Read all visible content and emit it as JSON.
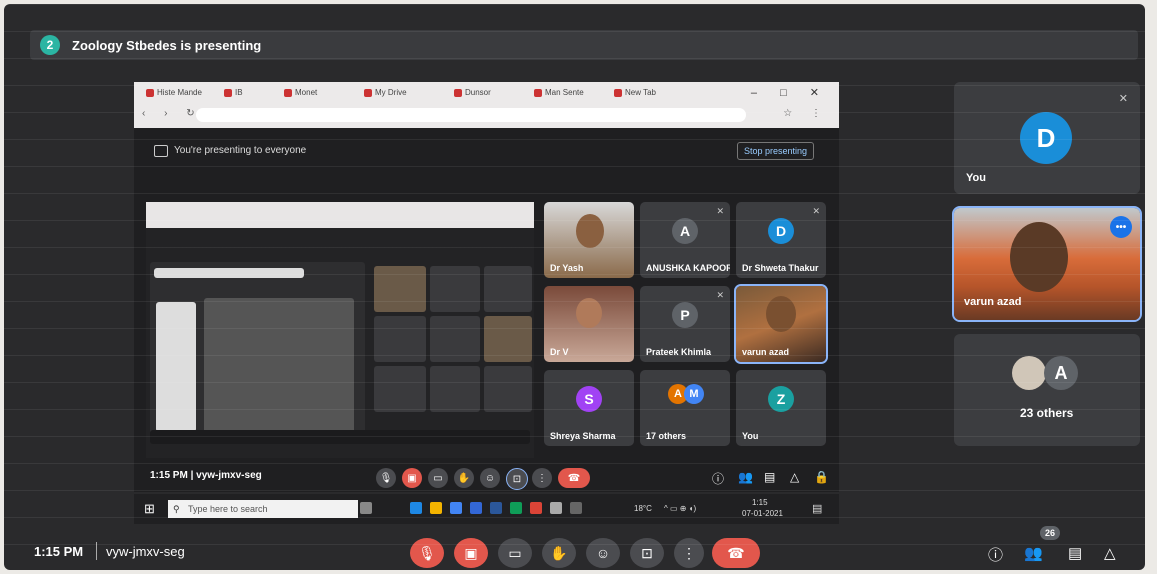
{
  "presentation": {
    "badge": "2",
    "text": "Zoology Stbedes is presenting"
  },
  "shared_screen": {
    "window_controls": "– □ ✕",
    "tabs": [
      "Histe Mande",
      "IB",
      "Monet",
      "My Drive",
      "Dunsor",
      "Man Sente",
      "New Tab"
    ],
    "banner_text": "You're presenting to everyone",
    "stop_button": "Stop presenting",
    "tiles": [
      {
        "name": "Dr Yash",
        "type": "video"
      },
      {
        "name": "ANUSHKA KAPOOR",
        "initial": "A",
        "color": "#5f6368"
      },
      {
        "name": "Dr Shweta Thakur",
        "initial": "D",
        "color": "#1a8ed8"
      },
      {
        "name": "Dr V",
        "type": "video"
      },
      {
        "name": "Prateek Khimla",
        "initial": "P",
        "color": "#5f6368"
      },
      {
        "name": "varun azad",
        "type": "video"
      },
      {
        "name": "Shreya Sharma",
        "initial": "S",
        "color": "#a142f4"
      },
      {
        "name": "17 others",
        "initials": [
          "A",
          "M"
        ]
      },
      {
        "name": "You",
        "initial": "Z",
        "color": "#1aa0a0"
      }
    ],
    "inner_time": "1:15 PM | vyw-jmxv-seg",
    "taskbar": {
      "search_placeholder": "Type here to search",
      "temp": "18°C",
      "clock": "1:15",
      "date": "07-01-2021"
    }
  },
  "sidebar": [
    {
      "name": "You",
      "initial": "D",
      "color": "#1a8ed8"
    },
    {
      "name": "varun azad"
    },
    {
      "name": "23 others",
      "initial": "A"
    }
  ],
  "bottom_bar": {
    "time": "1:15 PM",
    "meeting_code": "vyw-jmxv-seg",
    "people_count": "26"
  },
  "colors": {
    "accent": "#1a8ed8",
    "end_call": "#e2574c",
    "mute": "#e2574c"
  }
}
